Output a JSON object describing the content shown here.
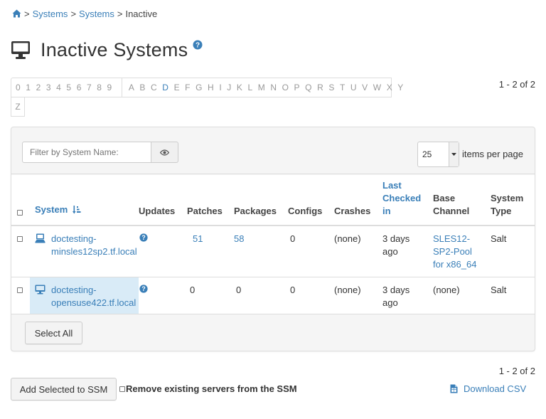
{
  "breadcrumb": {
    "home_icon": "home-icon",
    "separator": ">",
    "items": [
      "Systems",
      "Systems",
      "Inactive"
    ]
  },
  "page": {
    "title": "Inactive Systems",
    "title_icon": "monitor-icon",
    "help_icon": "question-circle-icon"
  },
  "alphabar": {
    "digits": [
      "0",
      "1",
      "2",
      "3",
      "4",
      "5",
      "6",
      "7",
      "8",
      "9"
    ],
    "letters": [
      "A",
      "B",
      "C",
      "D",
      "E",
      "F",
      "G",
      "H",
      "I",
      "J",
      "K",
      "L",
      "M",
      "N",
      "O",
      "P",
      "Q",
      "R",
      "S",
      "T",
      "U",
      "V",
      "W",
      "X",
      "Y"
    ],
    "last_row": "Z",
    "enabled": [
      "D"
    ]
  },
  "pager": {
    "count_text": "1 - 2 of 2"
  },
  "filter": {
    "placeholder": "Filter by System Name:",
    "button_icon": "eye-icon"
  },
  "per_page": {
    "value": "25",
    "label": "items per page"
  },
  "table": {
    "columns": {
      "system": "System",
      "updates": "Updates",
      "patches": "Patches",
      "packages": "Packages",
      "configs": "Configs",
      "crashes": "Crashes",
      "last_checked_1": "Last",
      "last_checked_2": "Checked",
      "last_checked_3": "in",
      "base_channel_1": "Base",
      "base_channel_2": "Channel",
      "system_type_1": "System",
      "system_type_2": "Type"
    },
    "rows": [
      {
        "name_1": "doctesting-",
        "name_2": "minsles12sp2.tf.local",
        "icon": "server-icon",
        "updates_icon": "question-circle-icon",
        "patches": "51",
        "packages": "58",
        "configs": "0",
        "crashes": "(none)",
        "last_checked_1": "3 days",
        "last_checked_2": "ago",
        "channel_1": "SLES12-",
        "channel_2": "SP2-Pool",
        "channel_3": "for x86_64",
        "type": "Salt"
      },
      {
        "name_1": "doctesting-",
        "name_2": "opensuse422.tf.local",
        "icon": "desktop-icon",
        "updates_icon": "question-circle-icon",
        "patches": "0",
        "packages": "0",
        "configs": "0",
        "crashes": "(none)",
        "last_checked_1": "3 days",
        "last_checked_2": "ago",
        "channel_1": "(none)",
        "type": "Salt"
      }
    ]
  },
  "actions": {
    "select_all": "Select All",
    "add_ssm": "Add Selected to SSM",
    "remove_existing": "Remove existing servers from the SSM",
    "download_csv": "Download CSV",
    "download_icon": "file-csv-icon"
  },
  "colors": {
    "link": "#3a7fb8",
    "highlight": "#d9ebf7"
  }
}
